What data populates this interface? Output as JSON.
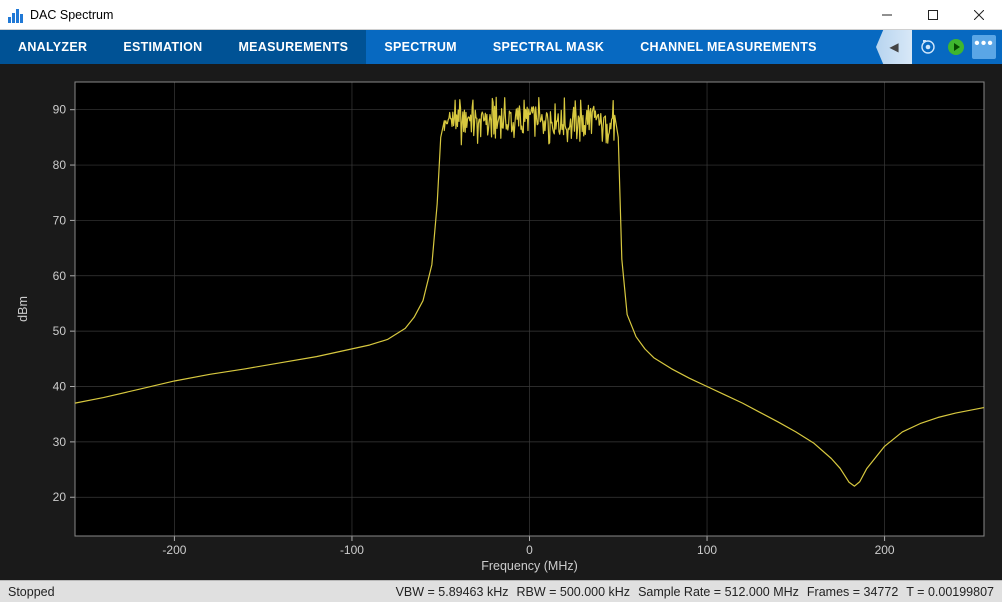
{
  "window": {
    "title": "DAC Spectrum"
  },
  "tabs": [
    {
      "label": "ANALYZER"
    },
    {
      "label": "ESTIMATION"
    },
    {
      "label": "MEASUREMENTS"
    },
    {
      "label": "SPECTRUM"
    },
    {
      "label": "SPECTRAL MASK"
    },
    {
      "label": "CHANNEL MEASUREMENTS"
    }
  ],
  "axes": {
    "xlabel": "Frequency (MHz)",
    "ylabel": "dBm",
    "xticks": [
      "-200",
      "-100",
      "0",
      "100",
      "200"
    ],
    "yticks": [
      "20",
      "30",
      "40",
      "50",
      "60",
      "70",
      "80",
      "90"
    ]
  },
  "status": {
    "state": "Stopped",
    "vbw": "VBW = 5.89463 kHz",
    "rbw": "RBW = 500.000 kHz",
    "rate": "Sample Rate = 512.000 MHz",
    "frames": "Frames = 34772",
    "time": "T = 0.00199807"
  },
  "chart_data": {
    "type": "line",
    "title": "",
    "xlabel": "Frequency (MHz)",
    "ylabel": "dBm",
    "xlim": [
      -256,
      256
    ],
    "ylim": [
      13,
      95
    ],
    "series": [
      {
        "name": "Spectrum",
        "color": "#d7c83f",
        "x": [
          -256,
          -240,
          -220,
          -200,
          -180,
          -160,
          -140,
          -120,
          -100,
          -90,
          -80,
          -70,
          -65,
          -60,
          -55,
          -52,
          -50,
          -48,
          48,
          50,
          52,
          55,
          60,
          65,
          70,
          80,
          90,
          100,
          110,
          120,
          130,
          140,
          150,
          160,
          170,
          175,
          180,
          183,
          186,
          190,
          200,
          210,
          220,
          230,
          240,
          256
        ],
        "y": [
          37,
          38,
          39.5,
          41,
          42.2,
          43.2,
          44.3,
          45.4,
          46.8,
          47.5,
          48.5,
          50.5,
          52.5,
          55.5,
          62,
          73,
          85,
          88,
          88,
          85,
          63,
          53,
          49,
          46.8,
          45.2,
          43.2,
          41.5,
          40,
          38.5,
          37,
          35.3,
          33.6,
          31.8,
          29.8,
          27,
          25.2,
          22.7,
          22,
          22.8,
          25.2,
          29.2,
          31.8,
          33.3,
          34.4,
          35.2,
          36.2
        ]
      }
    ],
    "noise_band": {
      "x_start": -48,
      "x_end": 48,
      "y_center": 88,
      "amplitude": 4
    }
  }
}
